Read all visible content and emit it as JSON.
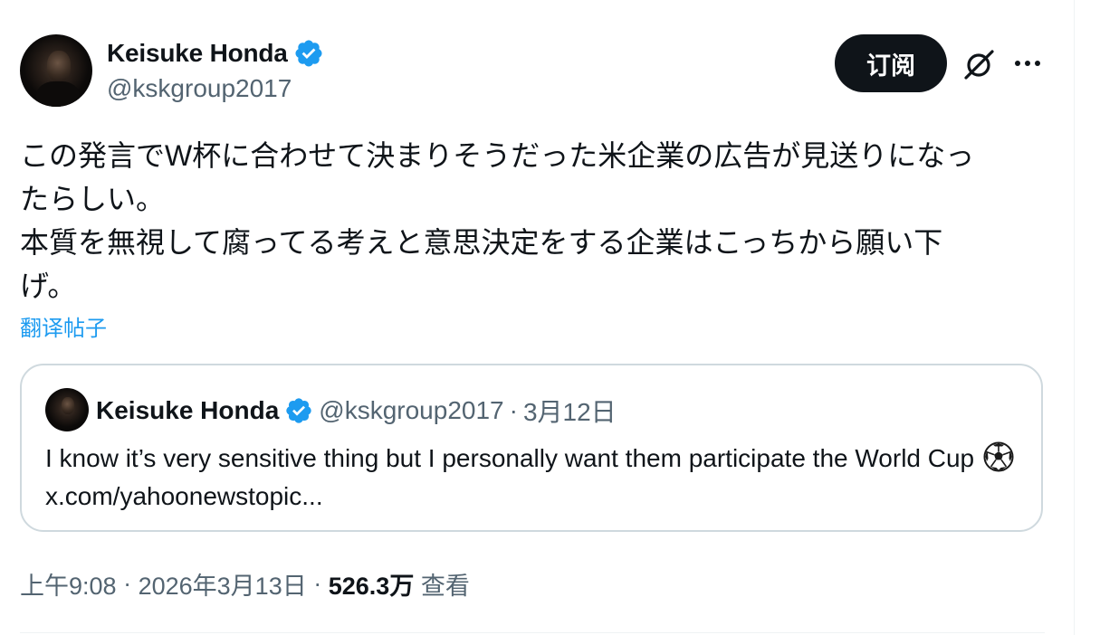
{
  "author": {
    "display_name": "Keisuke Honda",
    "handle": "@kskgroup2017",
    "verified": true,
    "verified_color": "#1d9bf0"
  },
  "actions": {
    "subscribe_label": "订阅",
    "grok_icon": "grok-icon",
    "more_icon": "more-icon"
  },
  "tweet": {
    "text": "この発言でW杯に合わせて決まりそうだった米企業の広告が見送りになっ\nたらしい。\n本質を無視して腐ってる考えと意思決定をする企業はこっちから願い下\nげ。",
    "translate_label": "翻译帖子"
  },
  "quote": {
    "display_name": "Keisuke Honda",
    "handle": "@kskgroup2017",
    "separator": "·",
    "date": "3月12日",
    "text_before": "I know it’s very sensitive thing but I personally want them participate the World Cup",
    "emoji": "soccer-ball-icon",
    "link": "x.com/yahoonewstopic..."
  },
  "meta": {
    "time": "上午9:08",
    "separator": "·",
    "date": "2026年3月13日",
    "views_count": "526.3万",
    "views_label": "查看"
  }
}
